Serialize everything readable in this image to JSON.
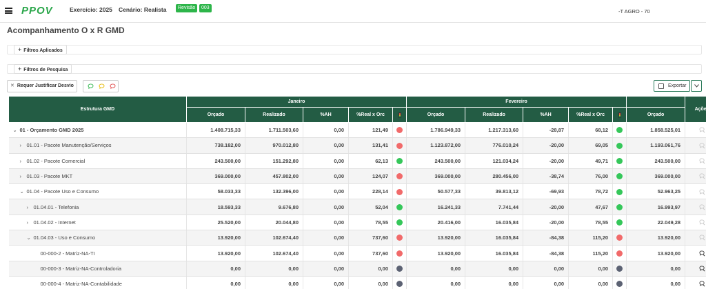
{
  "header": {
    "logo": "PPOV",
    "exercicio": "Exercício: 2025",
    "cenario": "Cenário: Realista",
    "revisao_label": "Revisão",
    "revisao_num": "003",
    "user": "-T AGRO - 70"
  },
  "page": {
    "title": "Acompanhamento O x R GMD"
  },
  "filters": {
    "aplicados": "Filtros Aplicados",
    "pesquisa": "Filtros de Pesquisa"
  },
  "toolbar": {
    "justificar": "Requer Justificar Desvio",
    "exportar": "Exportar"
  },
  "colors": {
    "header_green": "#235c44",
    "dot_red": "#f16a6a",
    "dot_green": "#35c75a",
    "dot_gray": "#5c6273"
  },
  "table": {
    "structure_header": "Estrutura GMD",
    "months": [
      "Janeiro",
      "Fevereiro"
    ],
    "cols": {
      "orcado": "Orçado",
      "realizado": "Realizado",
      "ah": "%AH",
      "real_orc": "%Real x Orc"
    },
    "actions_header": "Ações",
    "rows": [
      {
        "name": "01 - Orçamento GMD 2025",
        "level": 0,
        "expanded": true,
        "jan": [
          "1.408.715,33",
          "1.711.503,60",
          "0,00",
          "121,49"
        ],
        "jan_status": "red",
        "fev": [
          "1.786.949,33",
          "1.217.313,60",
          "-28,87",
          "68,12"
        ],
        "fev_status": "green",
        "mar_orc": "1.858.525,01",
        "action_icon": "comment-empty"
      },
      {
        "name": "01.01 - Pacote Manutenção/Serviços",
        "level": 1,
        "expanded": false,
        "jan": [
          "738.182,00",
          "970.012,80",
          "0,00",
          "131,41"
        ],
        "jan_status": "red",
        "fev": [
          "1.123.872,00",
          "776.010,24",
          "-20,00",
          "69,05"
        ],
        "fev_status": "green",
        "mar_orc": "1.193.061,76",
        "action_icon": "comment-empty"
      },
      {
        "name": "01.02 - Pacote Comercial",
        "level": 1,
        "expanded": false,
        "jan": [
          "243.500,00",
          "151.292,80",
          "0,00",
          "62,13"
        ],
        "jan_status": "green",
        "fev": [
          "243.500,00",
          "121.034,24",
          "-20,00",
          "49,71"
        ],
        "fev_status": "green",
        "mar_orc": "243.500,00",
        "action_icon": "comment-empty"
      },
      {
        "name": "01.03 - Pacote MKT",
        "level": 1,
        "expanded": false,
        "jan": [
          "369.000,00",
          "457.802,00",
          "0,00",
          "124,07"
        ],
        "jan_status": "red",
        "fev": [
          "369.000,00",
          "280.456,00",
          "-38,74",
          "76,00"
        ],
        "fev_status": "green",
        "mar_orc": "369.000,00",
        "action_icon": "comment-empty"
      },
      {
        "name": "01.04 - Pacote Uso e Consumo",
        "level": 1,
        "expanded": true,
        "jan": [
          "58.033,33",
          "132.396,00",
          "0,00",
          "228,14"
        ],
        "jan_status": "red",
        "fev": [
          "50.577,33",
          "39.813,12",
          "-69,93",
          "78,72"
        ],
        "fev_status": "green",
        "mar_orc": "52.963,25",
        "action_icon": "comment-empty"
      },
      {
        "name": "01.04.01 - Telefonia",
        "level": 2,
        "expanded": false,
        "jan": [
          "18.593,33",
          "9.676,80",
          "0,00",
          "52,04"
        ],
        "jan_status": "green",
        "fev": [
          "16.241,33",
          "7.741,44",
          "-20,00",
          "47,67"
        ],
        "fev_status": "green",
        "mar_orc": "16.993,97",
        "action_icon": "comment-empty"
      },
      {
        "name": "01.04.02 - Internet",
        "level": 2,
        "expanded": false,
        "jan": [
          "25.520,00",
          "20.044,80",
          "0,00",
          "78,55"
        ],
        "jan_status": "green",
        "fev": [
          "20.416,00",
          "16.035,84",
          "-20,00",
          "78,55"
        ],
        "fev_status": "green",
        "mar_orc": "22.049,28",
        "action_icon": "comment-empty"
      },
      {
        "name": "01.04.03 - Uso e Consumo",
        "level": 2,
        "expanded": true,
        "jan": [
          "13.920,00",
          "102.674,40",
          "0,00",
          "737,60"
        ],
        "jan_status": "red",
        "fev": [
          "13.920,00",
          "16.035,84",
          "-84,38",
          "115,20"
        ],
        "fev_status": "red",
        "mar_orc": "13.920,00",
        "action_icon": "comment-empty"
      },
      {
        "name": "00-000-2 - Matriz-NA-TI",
        "level": 3,
        "expanded": null,
        "jan": [
          "13.920,00",
          "102.674,40",
          "0,00",
          "737,60"
        ],
        "jan_status": "red",
        "fev": [
          "13.920,00",
          "16.035,84",
          "-84,38",
          "115,20"
        ],
        "fev_status": "red",
        "mar_orc": "13.920,00",
        "action_icon": "comment-dark"
      },
      {
        "name": "00-000-3 - Matriz-NA-Controladoria",
        "level": 3,
        "expanded": null,
        "jan": [
          "0,00",
          "0,00",
          "0,00",
          "0,00"
        ],
        "jan_status": "gray",
        "fev": [
          "0,00",
          "0,00",
          "0,00",
          "0,00"
        ],
        "fev_status": "gray",
        "mar_orc": "0,00",
        "action_icon": "comment-dark"
      },
      {
        "name": "00-000-4 - Matriz-NA-Contabilidade",
        "level": 3,
        "expanded": null,
        "jan": [
          "0,00",
          "0,00",
          "0,00",
          "0,00"
        ],
        "jan_status": "gray",
        "fev": [
          "0,00",
          "0,00",
          "0,00",
          "0,00"
        ],
        "fev_status": "gray",
        "mar_orc": "0,00",
        "action_icon": "comment-dark"
      }
    ]
  }
}
